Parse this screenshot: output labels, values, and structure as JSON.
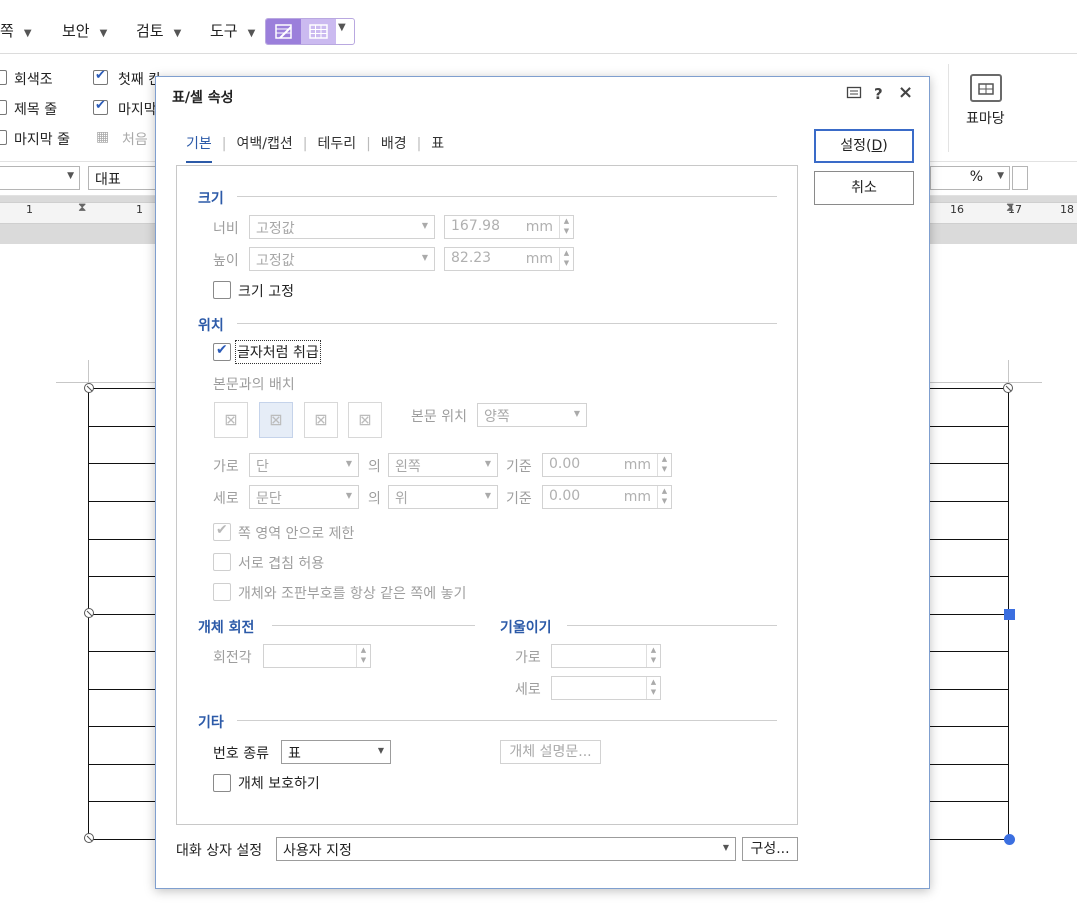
{
  "menubar": {
    "items": [
      "쪽",
      "보안",
      "검토",
      "도구"
    ]
  },
  "ribbon": {
    "checks": [
      {
        "label": "회색조",
        "checked": false
      },
      {
        "label": "제목 줄",
        "checked": false
      },
      {
        "label": "마지막 줄",
        "checked": false
      },
      {
        "label": "첫째 칸",
        "checked": true
      },
      {
        "label": "마지막",
        "checked": true
      }
    ],
    "cheoeum_label": "처음",
    "pyo_madang_label": "표마당"
  },
  "format_bar": {
    "style_value": "대표",
    "percent_label": "%"
  },
  "ruler": {
    "left_numbers": [
      "1",
      "1"
    ],
    "right_numbers": [
      "16",
      "17",
      "18"
    ]
  },
  "dialog": {
    "title": "표/셀 속성",
    "help_icon_glyph": "?",
    "close_icon_glyph": "×",
    "tabs": [
      "기본",
      "여백/캡션",
      "테두리",
      "배경",
      "표"
    ],
    "active_tab": "기본",
    "ok_label": "설정(D)",
    "ok_mnemonic_pre": "설정(",
    "ok_mnemonic": "D",
    "ok_mnemonic_post": ")",
    "cancel_label": "취소",
    "size": {
      "section": "크기",
      "width_label": "너비",
      "width_mode": "고정값",
      "width_value": "167.98",
      "height_label": "높이",
      "height_mode": "고정값",
      "height_value": "82.23",
      "unit": "mm",
      "fix_size_label": "크기 고정",
      "fix_size_checked": false
    },
    "position": {
      "section": "위치",
      "treat_as_char_label": "글자처럼 취급",
      "treat_as_char_checked": true,
      "layout_label": "본문과의 배치",
      "body_pos_label": "본문 위치",
      "body_pos_value": "양쪽",
      "horiz_label": "가로",
      "horiz_ref": "단",
      "of_label": "의",
      "horiz_align": "왼쪽",
      "base_label": "기준",
      "horiz_offset": "0.00",
      "vert_label": "세로",
      "vert_ref": "문단",
      "vert_align": "위",
      "vert_offset": "0.00",
      "unit": "mm",
      "limit_label": "쪽 영역 안으로 제한",
      "limit_checked": true,
      "overlap_label": "서로 겹침 허용",
      "overlap_checked": false,
      "same_page_label": "개체와 조판부호를 항상 같은 쪽에 놓기",
      "same_page_checked": false
    },
    "rotation": {
      "section": "개체 회전",
      "angle_label": "회전각"
    },
    "skew": {
      "section": "기울이기",
      "horiz_label": "가로",
      "vert_label": "세로"
    },
    "etc": {
      "section": "기타",
      "number_type_label": "번호 종류",
      "number_type_value": "표",
      "description_button": "개체 설명문...",
      "protect_label": "개체 보호하기",
      "protect_checked": false
    },
    "footer": {
      "dialog_setting_label": "대화 상자 설정",
      "dialog_setting_value": "사용자 지정",
      "configure_button": "구성..."
    }
  }
}
